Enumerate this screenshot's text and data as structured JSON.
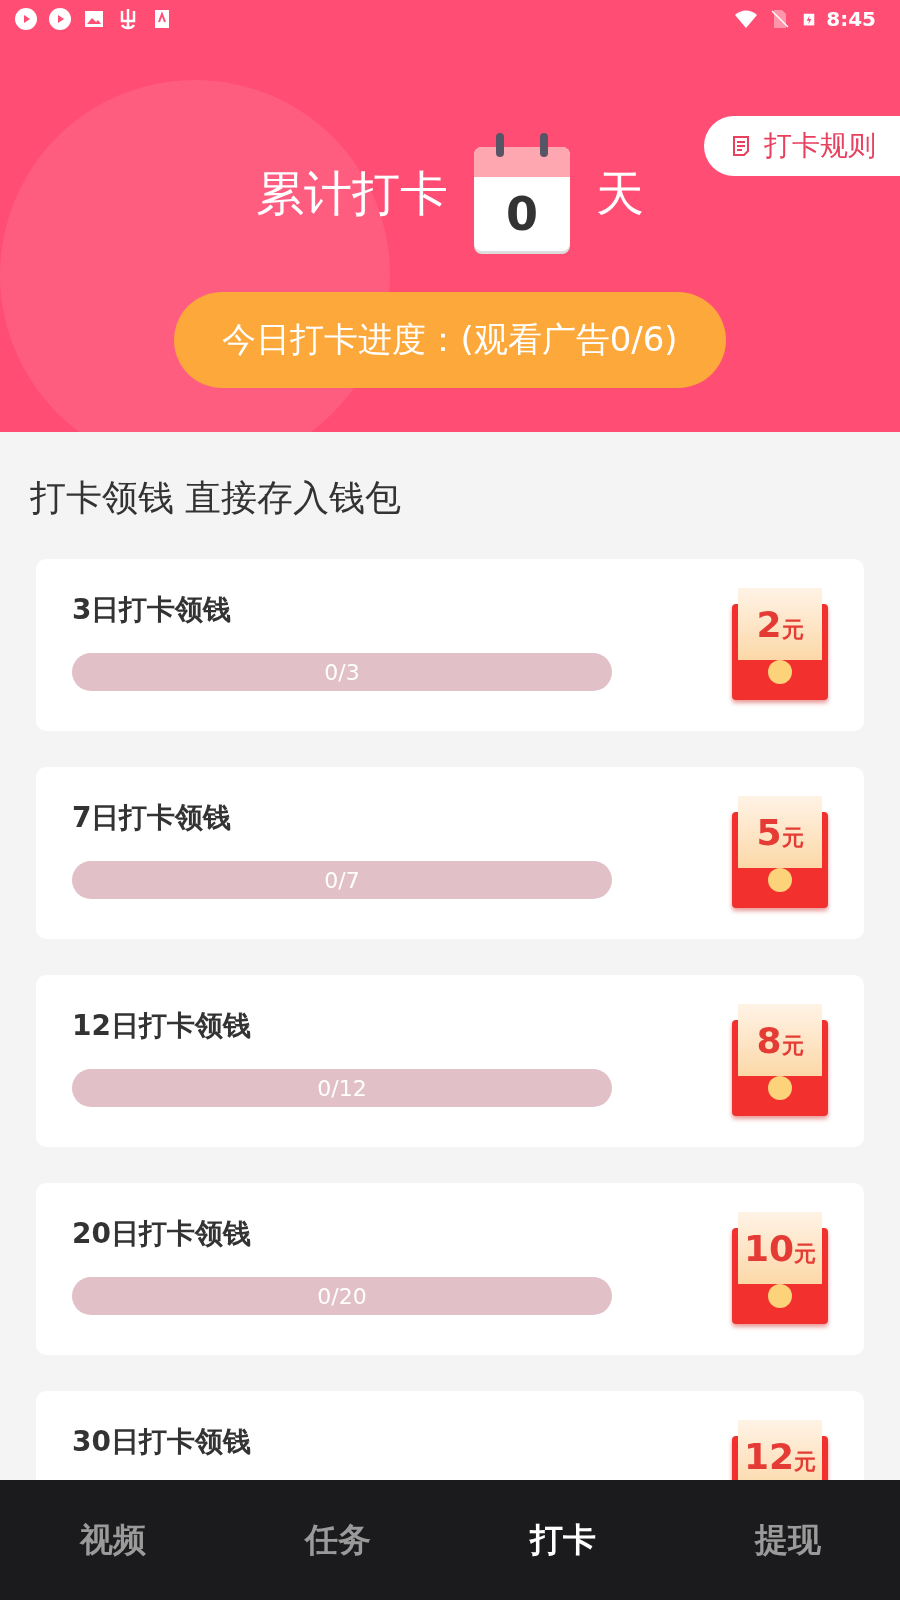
{
  "status_bar": {
    "time": "8:45"
  },
  "header": {
    "total_label": "累计打卡",
    "days": "0",
    "unit": "天",
    "rules_button": "打卡规则",
    "progress_button": "今日打卡进度：(观看广告0/6)"
  },
  "section_title": "打卡领钱 直接存入钱包",
  "rewards": [
    {
      "title": "3日打卡领钱",
      "reading": "0/3",
      "amount": "2",
      "currency": "元"
    },
    {
      "title": "7日打卡领钱",
      "reading": "0/7",
      "amount": "5",
      "currency": "元"
    },
    {
      "title": "12日打卡领钱",
      "reading": "0/12",
      "amount": "8",
      "currency": "元"
    },
    {
      "title": "20日打卡领钱",
      "reading": "0/20",
      "amount": "10",
      "currency": "元"
    },
    {
      "title": "30日打卡领钱",
      "amount": "12",
      "currency": "元"
    }
  ],
  "tabs": [
    {
      "label": "视频",
      "selected": false
    },
    {
      "label": "任务",
      "selected": false
    },
    {
      "label": "打卡",
      "selected": true
    },
    {
      "label": "提现",
      "selected": false
    }
  ]
}
